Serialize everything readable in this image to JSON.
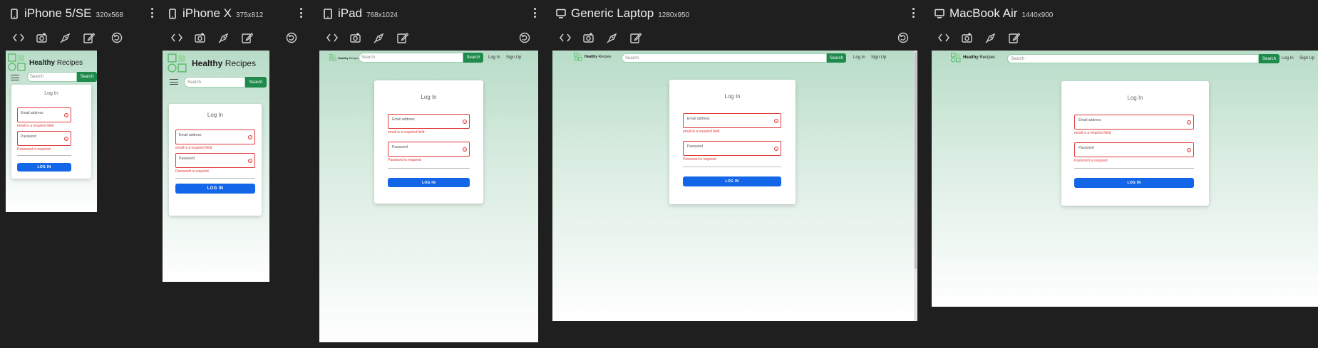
{
  "colors": {
    "background": "#1f1f1f",
    "brand_green": "#1e8a4b",
    "error_red": "#e03b3b",
    "login_blue": "#1366e8"
  },
  "toolbar_icons": [
    "code-icon",
    "camera-icon",
    "pen-tool-icon",
    "edit-icon"
  ],
  "site": {
    "brand_bold": "Healthy",
    "brand_rest": " Recipes",
    "search_placeholder": "Search",
    "search_button": "Search",
    "nav_login": "Log In",
    "nav_signup": "Sign Up",
    "card_title": "Log In",
    "email_label": "Email address",
    "email_error": "email is a required field",
    "password_label": "Password",
    "password_error": "Password is required",
    "login_button": "LOG IN"
  },
  "devices": [
    {
      "name": "iPhone 5/SE",
      "size": "320x568",
      "type": "phone"
    },
    {
      "name": "iPhone X",
      "size": "375x812",
      "type": "phone"
    },
    {
      "name": "iPad",
      "size": "768x1024",
      "type": "tablet"
    },
    {
      "name": "Generic Laptop",
      "size": "1280x950",
      "type": "laptop"
    },
    {
      "name": "MacBook Air",
      "size": "1440x900",
      "type": "laptop"
    }
  ]
}
